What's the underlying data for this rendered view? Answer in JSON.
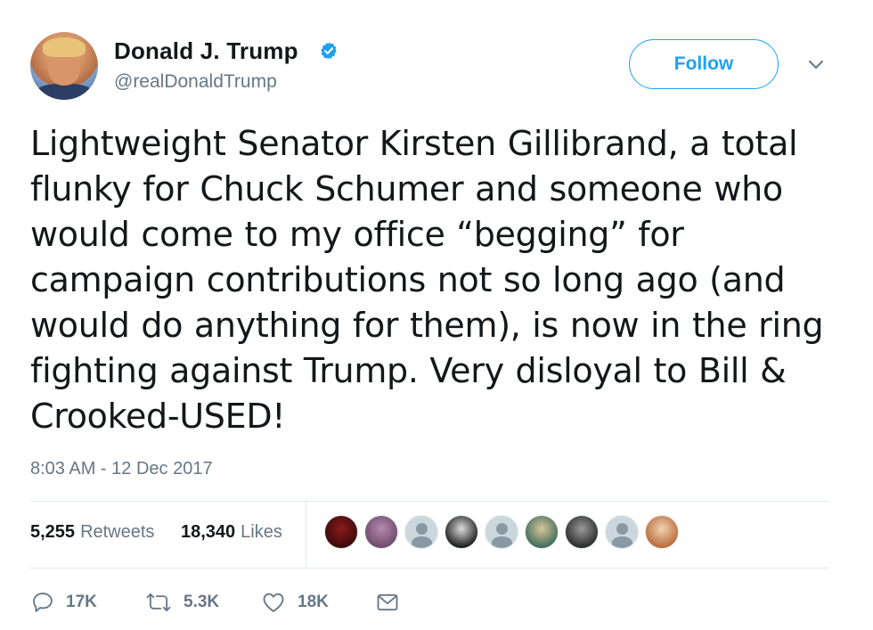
{
  "author": {
    "name": "Donald J. Trump",
    "handle": "@realDonaldTrump",
    "verified": true
  },
  "follow_button": {
    "label": "Follow"
  },
  "tweet": {
    "text": "Lightweight Senator Kirsten Gillibrand, a total flunky for Chuck Schumer and someone who would come to my office “begging” for campaign contributions not so long ago (and would do anything for them), is now in the ring fighting against Trump. Very disloyal to Bill & Crooked-USED!",
    "timestamp": "8:03 AM - 12 Dec 2017"
  },
  "stats": {
    "retweets_count": "5,255",
    "retweets_label": "Retweets",
    "likes_count": "18,340",
    "likes_label": "Likes"
  },
  "liker_avatars": [
    {
      "type": "photo",
      "colors": [
        "#3a0a0a",
        "#8a1a1a"
      ]
    },
    {
      "type": "photo",
      "colors": [
        "#6d4a6a",
        "#b58ab0"
      ]
    },
    {
      "type": "default"
    },
    {
      "type": "photo",
      "colors": [
        "#1a1a1a",
        "#dcdcdc"
      ]
    },
    {
      "type": "default"
    },
    {
      "type": "photo",
      "colors": [
        "#3f6a5a",
        "#d8c79a"
      ]
    },
    {
      "type": "photo",
      "colors": [
        "#2a2a2a",
        "#9a9a9a"
      ]
    },
    {
      "type": "default"
    },
    {
      "type": "photo",
      "colors": [
        "#b86a3a",
        "#f2d2b0"
      ]
    }
  ],
  "actions": {
    "reply_count": "17K",
    "retweet_count": "5.3K",
    "like_count": "18K"
  },
  "colors": {
    "accent": "#1da1f2",
    "text": "#14171a",
    "secondary": "#657786",
    "divider": "#e1e8ed"
  },
  "icons": [
    "verified-badge-icon",
    "chevron-down-icon",
    "reply-icon",
    "retweet-icon",
    "like-heart-icon",
    "direct-message-icon"
  ]
}
